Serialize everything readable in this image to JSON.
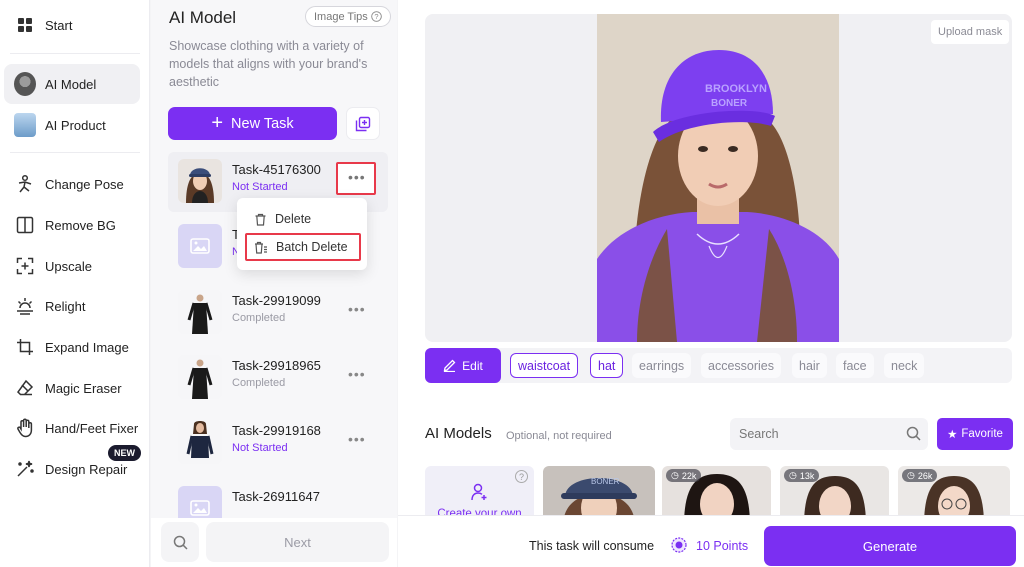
{
  "nav": {
    "items": [
      {
        "label": "Start",
        "icon": "grid-icon"
      },
      {
        "label": "AI Model",
        "icon": "model-avatar-icon"
      },
      {
        "label": "AI Product",
        "icon": "product-icon"
      },
      {
        "label": "Change Pose",
        "icon": "pose-icon"
      },
      {
        "label": "Remove BG",
        "icon": "remove-bg-icon"
      },
      {
        "label": "Upscale",
        "icon": "upscale-icon"
      },
      {
        "label": "Relight",
        "icon": "relight-icon"
      },
      {
        "label": "Expand Image",
        "icon": "crop-icon"
      },
      {
        "label": "Magic Eraser",
        "icon": "eraser-icon"
      },
      {
        "label": "Hand/Feet Fixer",
        "icon": "hand-icon"
      },
      {
        "label": "Design Repair",
        "icon": "magic-wand-icon"
      }
    ],
    "new_badge": "NEW"
  },
  "panel": {
    "title": "AI Model",
    "image_tips": "Image Tips",
    "description": "Showcase clothing with a variety of models that aligns with your brand's aesthetic",
    "new_task_label": "New Task",
    "tasks": [
      {
        "name": "Task-45176300",
        "status": "Not Started"
      },
      {
        "name": "T",
        "status": "N"
      },
      {
        "name": "Task-29919099",
        "status": "Completed"
      },
      {
        "name": "Task-29918965",
        "status": "Completed"
      },
      {
        "name": "Task-29919168",
        "status": "Not Started"
      },
      {
        "name": "Task-26911647",
        "status": ""
      }
    ],
    "menu": {
      "delete": "Delete",
      "batch_delete": "Batch Delete"
    },
    "next_label": "Next"
  },
  "main": {
    "upload_mask": "Upload mask",
    "edit_label": "Edit",
    "tags": [
      "waistcoat",
      "hat",
      "earrings",
      "accessories",
      "hair",
      "face",
      "neck"
    ],
    "selected_tags": [
      "waistcoat",
      "hat"
    ],
    "models_title": "AI Models",
    "models_subtitle": "Optional, not required",
    "search_placeholder": "Search",
    "favorite_label": "Favorite",
    "create_own_label": "Create your own",
    "model_counts": [
      "22k",
      "13k",
      "26k"
    ],
    "consume_text": "This task will consume",
    "points": "10 Points",
    "generate_label": "Generate"
  },
  "colors": {
    "accent": "#7b2ff2",
    "highlight_box": "#e8394a"
  }
}
